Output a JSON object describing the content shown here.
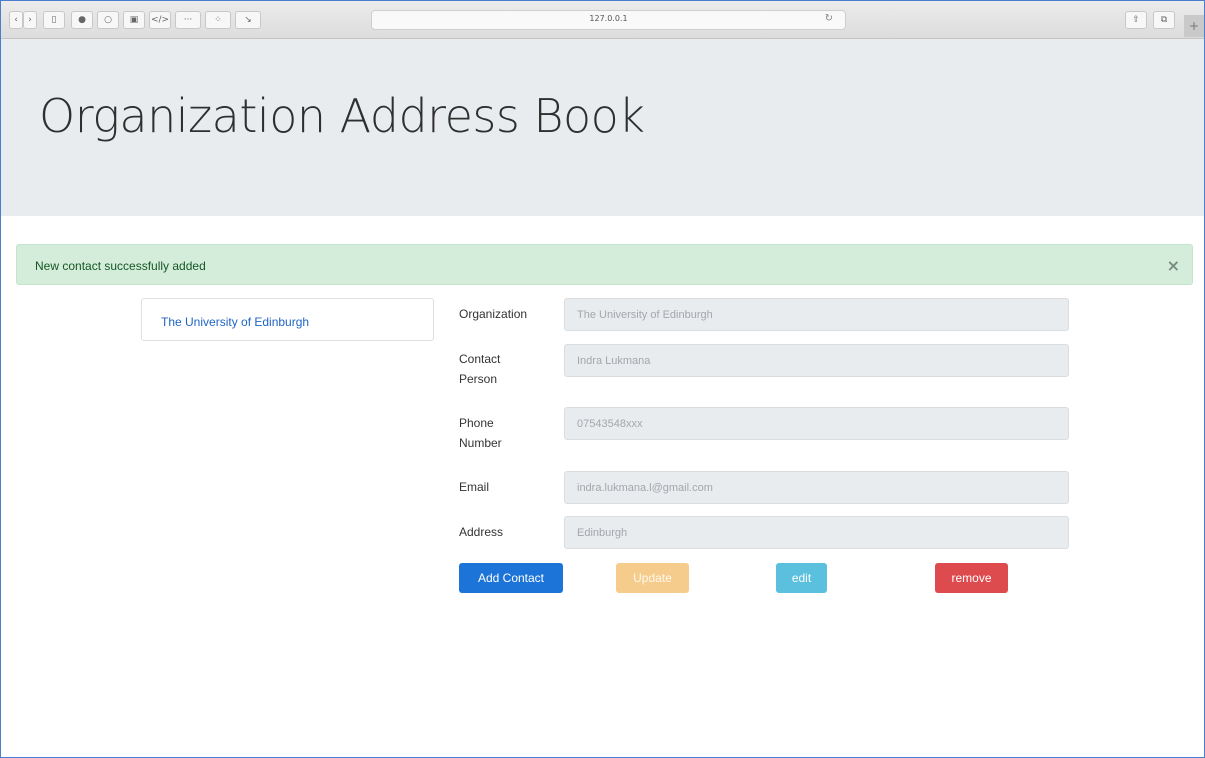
{
  "browser": {
    "url": "127.0.0.1",
    "reload_icon": "reload-icon",
    "toolbar_icons": [
      "back-icon",
      "forward-icon",
      "sidebar-icon",
      "pocket-icon",
      "opera-icon",
      "reader-icon",
      "developer-icon",
      "extension-icon",
      "share-network-icon",
      "arrow-icon",
      "share-icon",
      "tabs-icon"
    ]
  },
  "header": {
    "title": "Organization Address Book"
  },
  "alert": {
    "message": "New contact successfully added",
    "close": "×"
  },
  "organizations": [
    {
      "name": "The University of Edinburgh"
    }
  ],
  "form": {
    "organization": {
      "label": "Organization",
      "value": "The University of Edinburgh"
    },
    "contact_person": {
      "label_line1": "Contact",
      "label_line2": "Person",
      "value": "Indra Lukmana"
    },
    "phone_number": {
      "label_line1": "Phone",
      "label_line2": "Number",
      "value": "07543548xxx"
    },
    "email": {
      "label": "Email",
      "value": "indra.lukmana.l@gmail.com"
    },
    "address": {
      "label": "Address",
      "value": "Edinburgh"
    }
  },
  "buttons": {
    "add": "Add Contact",
    "update": "Update",
    "edit": "edit",
    "remove": "remove"
  },
  "colors": {
    "primary": "#1d74d8",
    "warning": "#f5cc8b",
    "info": "#5bc0de",
    "danger": "#dd4b4f",
    "alert_bg": "#d4edda",
    "jumbotron_bg": "#e9ecef"
  }
}
